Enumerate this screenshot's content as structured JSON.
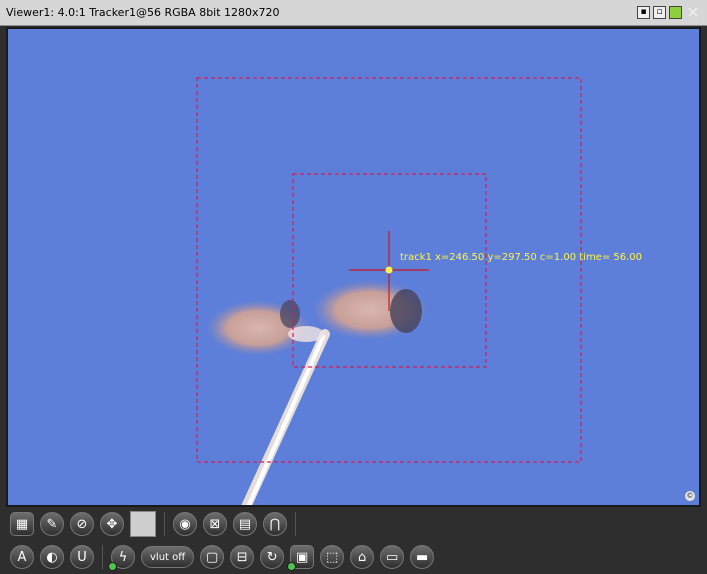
{
  "window": {
    "title": "Viewer1: 4.0:1 Tracker1@56 RGBA 8bit 1280x720",
    "controls": [
      "minimize-icon",
      "maximize-icon",
      "color-grid-icon",
      "close-icon"
    ],
    "close_glyph": "✕"
  },
  "viewer": {
    "background_color": "#5d7fd9",
    "track_label": "track1 x=246.50 y=297.50 c=1.00 time= 56.00",
    "overlay_color": "#d21a5a",
    "tracker_point_color": "#fff34a",
    "crosshair_color": "#d0141e",
    "corner_glyph": "©"
  },
  "toolbar_top": {
    "buttons": [
      "grid-icon",
      "pick-color-icon",
      "no-key-icon",
      "move-icon",
      "swatch",
      "eyes-icon",
      "box-x-icon",
      "layers-icon",
      "magnet-icon"
    ]
  },
  "toolbar_bottom": {
    "a_label": "A",
    "u_label": "U",
    "vlut_label": "vlut off",
    "buttons": [
      "alpha-icon",
      "color-wheel-icon",
      "u-icon",
      "lightning-icon",
      "vlut-off-button",
      "frame-icon",
      "fit-icon",
      "rotate-icon",
      "monitor-icon",
      "mask-icon",
      "house-icon",
      "film-icon",
      "reel-icon"
    ]
  }
}
